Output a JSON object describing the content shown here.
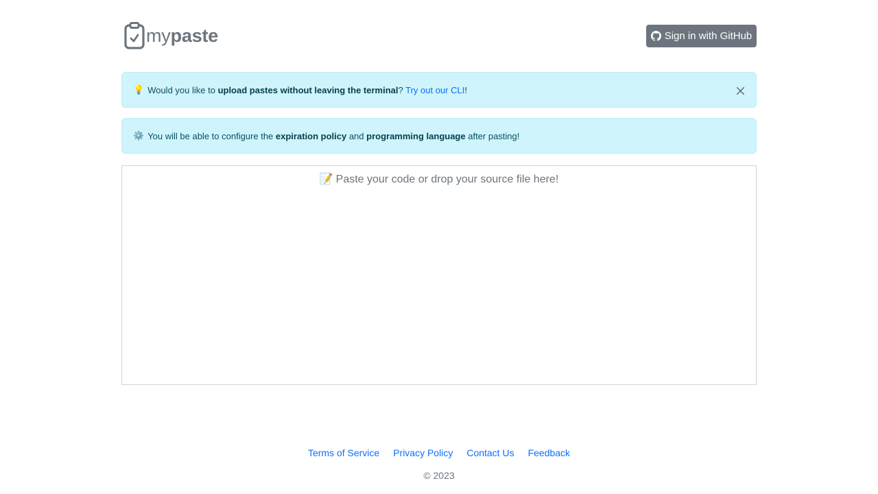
{
  "header": {
    "logo": {
      "prefix": "my",
      "suffix": "paste",
      "icon": "clipboard-check-icon"
    },
    "signin_label": "Sign in with GitHub",
    "signin_icon": "github-icon"
  },
  "alerts": {
    "cli": {
      "emoji": "💡",
      "text_before": "Would you like to ",
      "bold": "upload pastes without leaving the terminal",
      "text_mid": "? ",
      "link": "Try out our CLI",
      "text_after": "!",
      "close_icon": "close-icon"
    },
    "config": {
      "emoji": "⚙️",
      "text_1": "You will be able to configure the ",
      "bold_1": "expiration policy",
      "text_2": " and ",
      "bold_2": "programming language",
      "text_3": " after pasting!"
    }
  },
  "paste": {
    "emoji": "📝",
    "placeholder": "Paste your code or drop your source file here!"
  },
  "footer": {
    "links": [
      "Terms of Service",
      "Privacy Policy",
      "Contact Us",
      "Feedback"
    ],
    "copyright": "© 2023"
  },
  "colors": {
    "primary_link": "#0d6efd",
    "secondary": "#6c757d",
    "alert_bg": "#cff4fc",
    "alert_text": "#055160"
  }
}
